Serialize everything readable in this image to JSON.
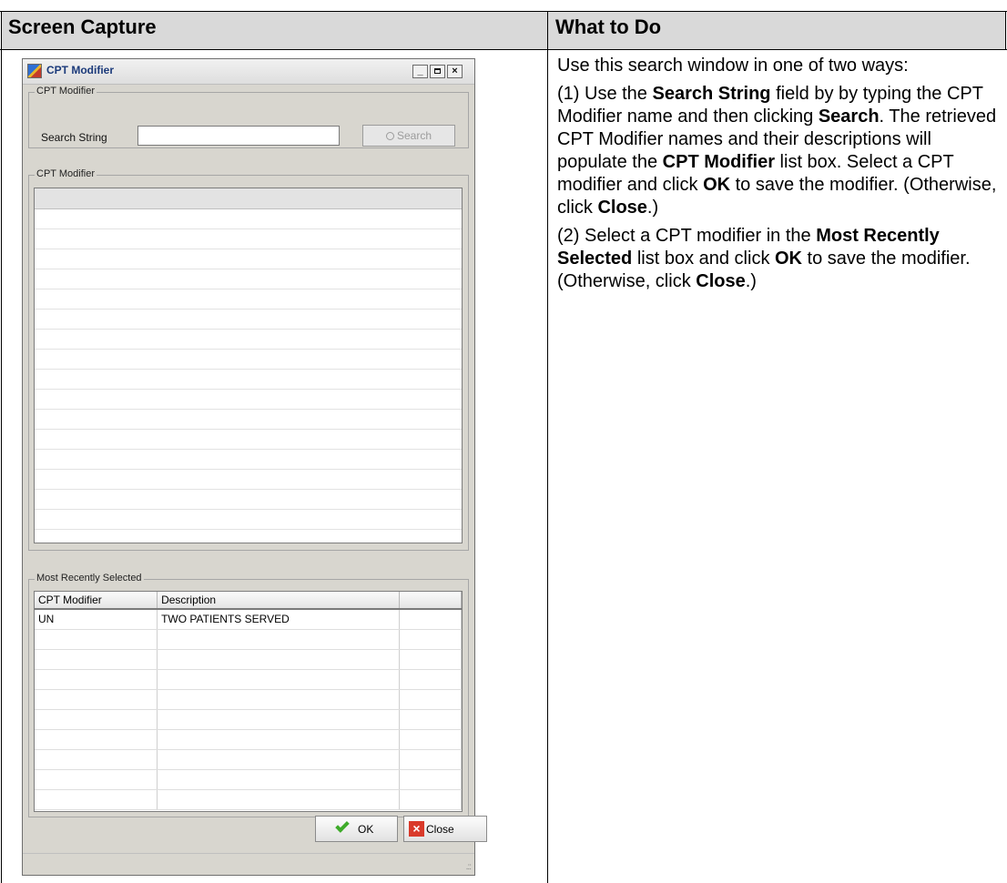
{
  "table_headers": {
    "left": "Screen Capture",
    "right": "What to Do"
  },
  "window": {
    "title": "CPT Modifier",
    "search_group_title": "CPT Modifier",
    "search_label": "Search String",
    "search_value": "",
    "search_button_label": "Search",
    "results_group_title": "CPT Modifier",
    "recent_group_title": "Most Recently Selected",
    "recent_columns": [
      "CPT Modifier",
      "Description",
      ""
    ],
    "recent_rows": [
      [
        "UN",
        "TWO PATIENTS SERVED",
        ""
      ]
    ],
    "ok_label": "OK",
    "close_label": "Close"
  },
  "instructions": {
    "p1": "Use this search window in one of two ways:",
    "p2": {
      "t1": "(1) Use the ",
      "b1": "Search String",
      "t2": " field by by typing the CPT Modifier name and then clicking ",
      "b2": "Search",
      "t3": ". The retrieved CPT Modifier names and their descriptions will populate the ",
      "b3": "CPT Modifier",
      "t4": " list box. Select a CPT modifier and click ",
      "b4": "OK",
      "t5": " to save the modifier. (Otherwise, click ",
      "b5": "Close",
      "t6": ".)"
    },
    "p3": {
      "t1": "(2) Select a CPT modifier in the ",
      "b1": "Most Recently Selected",
      "t2": " list box and click ",
      "b2": "OK",
      "t3": " to save the modifier. (Otherwise, click ",
      "b3": "Close",
      "t4": ".)"
    }
  }
}
